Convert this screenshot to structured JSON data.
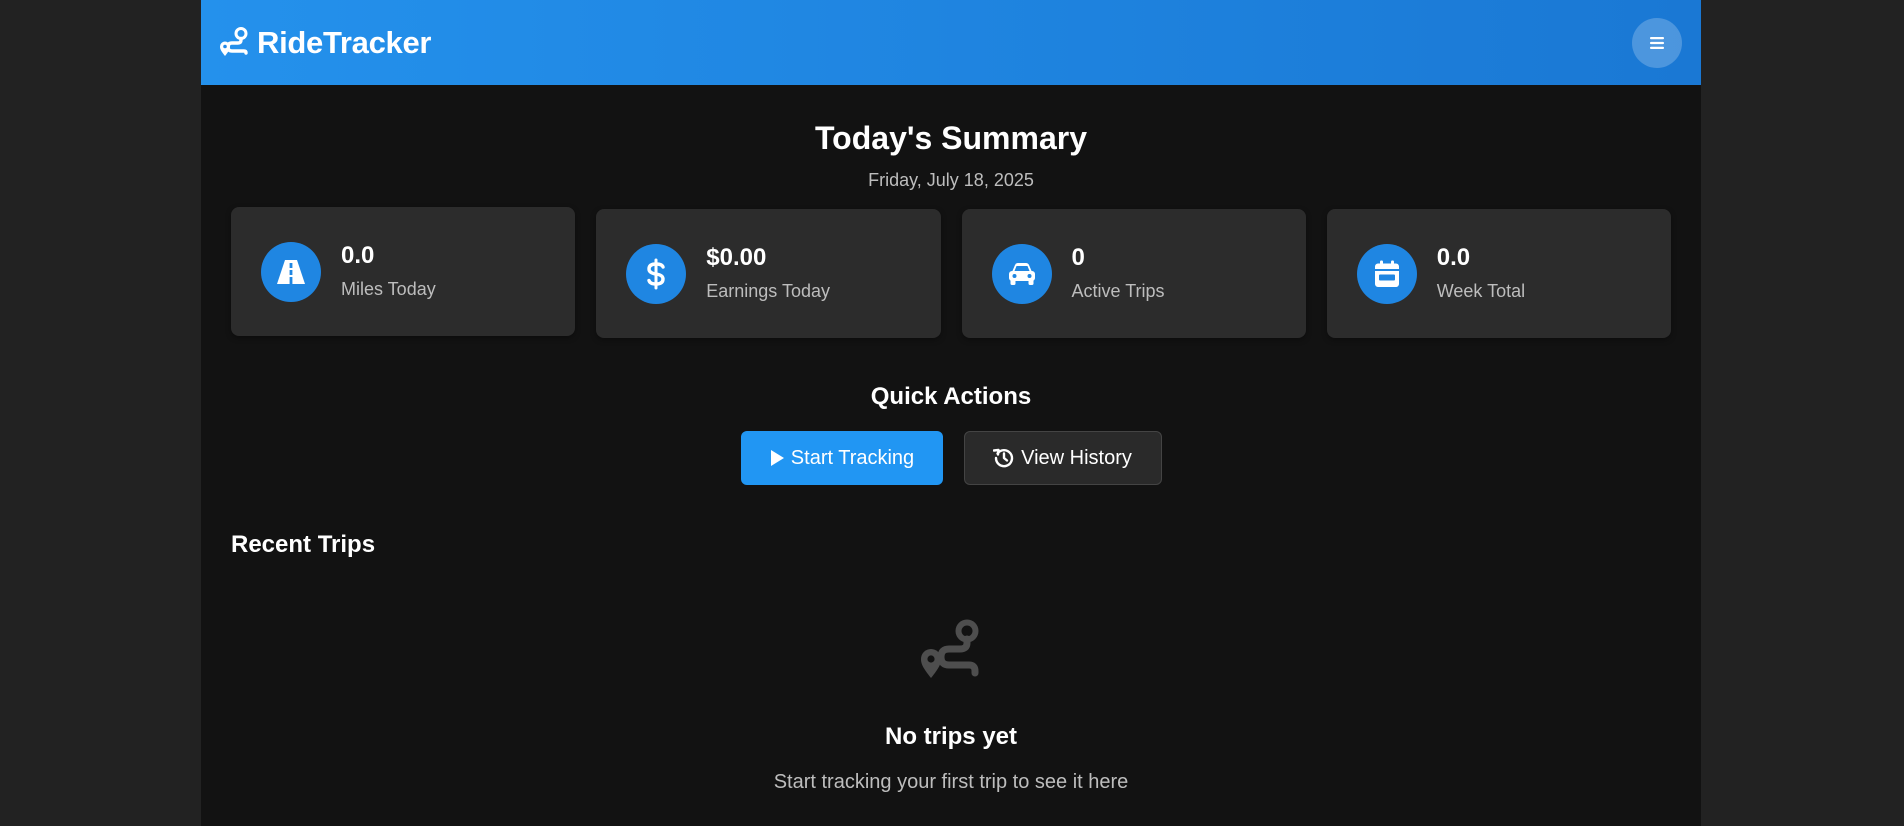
{
  "header": {
    "app_name": "RideTracker",
    "logo_icon": "route-icon",
    "menu_icon": "menu-icon"
  },
  "summary": {
    "title": "Today's Summary",
    "date": "Friday, July 18, 2025"
  },
  "stats": [
    {
      "icon": "road-icon",
      "value": "0.0",
      "label": "Miles Today"
    },
    {
      "icon": "dollar-icon",
      "value": "$0.00",
      "label": "Earnings Today"
    },
    {
      "icon": "car-icon",
      "value": "0",
      "label": "Active Trips"
    },
    {
      "icon": "calendar-icon",
      "value": "0.0",
      "label": "Week Total"
    }
  ],
  "quick_actions": {
    "title": "Quick Actions",
    "start_label": "Start Tracking",
    "history_label": "View History"
  },
  "recent_trips": {
    "title": "Recent Trips",
    "empty_title": "No trips yet",
    "empty_subtitle": "Start tracking your first trip to see it here"
  },
  "colors": {
    "accent": "#2196f3",
    "header_start": "#2491ec",
    "header_end": "#1a78d4",
    "page_bg": "#121212",
    "card_bg": "#2c2c2c",
    "muted_text": "#bdbdbd"
  }
}
